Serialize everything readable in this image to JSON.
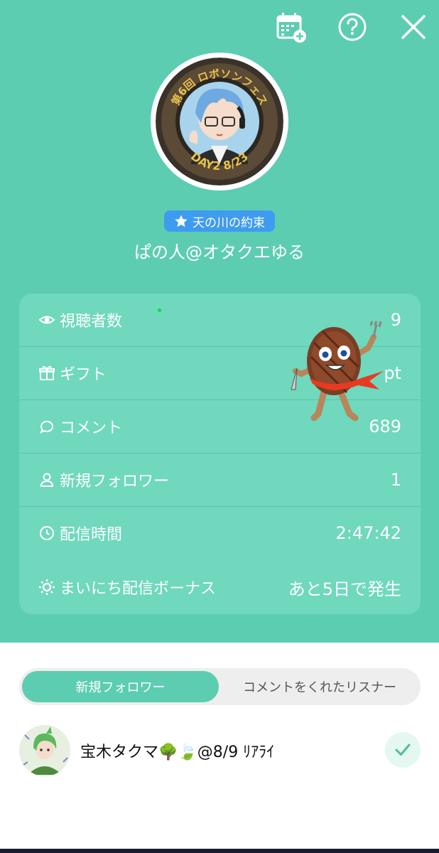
{
  "header": {
    "calendar_icon": "calendar-plus-icon",
    "help_icon": "question-circle-icon",
    "close_icon": "close-icon"
  },
  "profile": {
    "avatar_text_top": "第6回 ロボソンフェス",
    "avatar_text_bottom": "DAY2 8/23",
    "badge_label": "天の川の約束",
    "name": "ぱの人@オタクエゆる"
  },
  "stats": [
    {
      "label": "視聴者数",
      "value": "9",
      "icon": "eye-icon"
    },
    {
      "label": "ギフト",
      "value": "pt",
      "icon": "gift-icon"
    },
    {
      "label": "コメント",
      "value": "689",
      "icon": "comment-icon"
    },
    {
      "label": "新規フォロワー",
      "value": "1",
      "icon": "user-icon"
    },
    {
      "label": "配信時間",
      "value": "2:47:42",
      "icon": "clock-icon"
    },
    {
      "label": "まいにち配信ボーナス",
      "value": "あと5日で発生",
      "icon": "sun-icon"
    }
  ],
  "tabs": {
    "active": "新規フォロワー",
    "inactive": "コメントをくれたリスナー"
  },
  "followers": [
    {
      "name": "宝木タクマ🌳🍃@8/9 ﾘｱﾗｲ",
      "followed": true
    }
  ],
  "colors": {
    "primary": "#5dcdb1",
    "card": "#6fd8bd",
    "badge": "#3f9bf0"
  }
}
